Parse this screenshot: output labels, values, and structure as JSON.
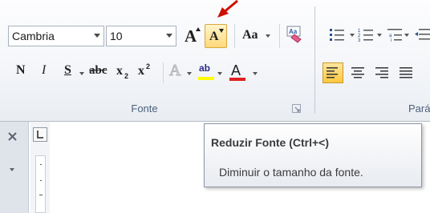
{
  "font_group": {
    "label": "Fonte",
    "font_name": "Cambria",
    "font_size": "10",
    "grow_font_glyph": "A",
    "shrink_font_glyph": "A",
    "change_case_glyph": "Aa",
    "bold_glyph": "N",
    "italic_glyph": "I",
    "underline_glyph": "S",
    "strikethrough_glyph": "abc",
    "subscript_glyph": "x",
    "superscript_glyph": "x",
    "text_effects_glyph": "A",
    "highlight_glyph": "ab",
    "font_color_glyph": "A",
    "sub_index": "2",
    "super_index": "2"
  },
  "paragraph_group": {
    "label_partial": "Pará"
  },
  "tooltip": {
    "title": "Reduzir Fonte (Ctrl+<)",
    "description": "Diminuir o tamanho da fonte."
  },
  "colors": {
    "arrow": "#cc1100",
    "highlight": "#ffff00",
    "font_color": "#e02020",
    "hover_fill": "#ffd97a",
    "paragraph_active": "#ffc83d"
  },
  "icons": [
    "red-pointer-arrow-icon",
    "clear-formatting-icon",
    "bullets-icon",
    "numbering-icon",
    "multilevel-list-icon",
    "align-left-icon",
    "center-icon",
    "align-right-icon",
    "justify-icon",
    "dialog-launcher-icon",
    "close-icon",
    "tab-selector-icon"
  ]
}
